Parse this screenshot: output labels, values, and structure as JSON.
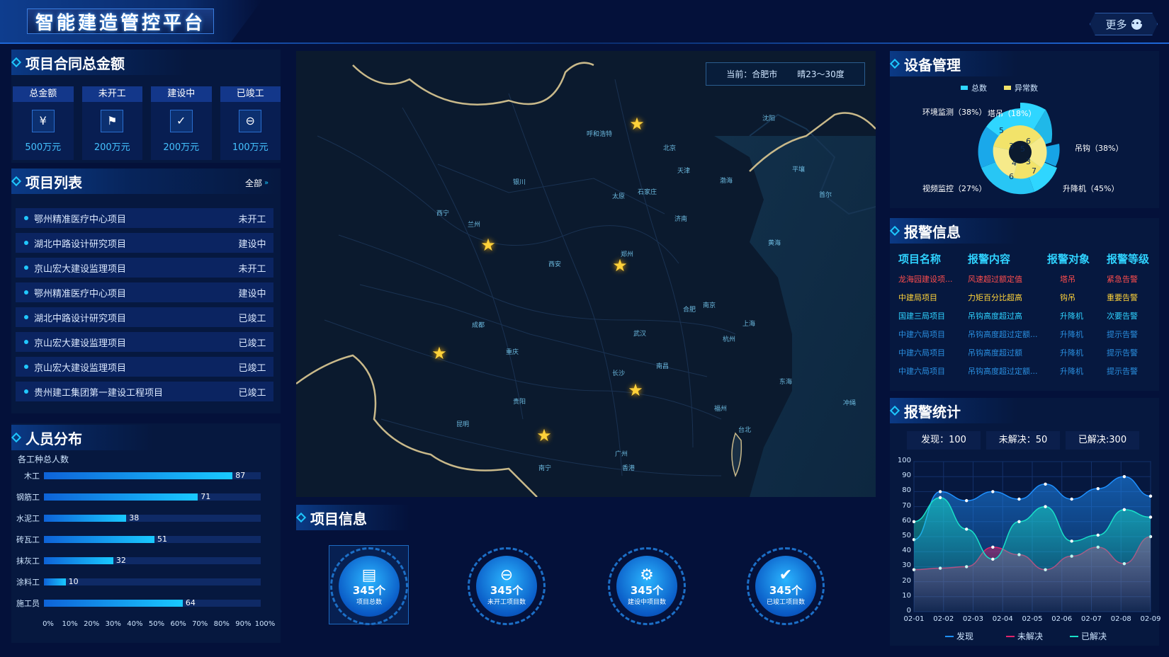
{
  "app": {
    "title": "智能建造管控平台",
    "more_label": "更多"
  },
  "contract": {
    "title": "项目合同总金额",
    "items": [
      {
        "head": "总金额",
        "icon": "money-bag-icon",
        "glyph": "💰",
        "value": "500万元"
      },
      {
        "head": "未开工",
        "icon": "flag-icon",
        "glyph": "⚑",
        "value": "200万元"
      },
      {
        "head": "建设中",
        "icon": "clipboard-check-icon",
        "glyph": "✓",
        "value": "200万元"
      },
      {
        "head": "已竣工",
        "icon": "minus-circle-icon",
        "glyph": "⊖",
        "value": "100万元"
      }
    ]
  },
  "project_list": {
    "title": "项目列表",
    "all_label": "全部",
    "rows": [
      {
        "name": "鄂州精准医疗中心项目",
        "status": "未开工"
      },
      {
        "name": "湖北中路设计研究项目",
        "status": "建设中"
      },
      {
        "name": "京山宏大建设监理项目",
        "status": "未开工"
      },
      {
        "name": "鄂州精准医疗中心项目",
        "status": "建设中"
      },
      {
        "name": "湖北中路设计研究项目",
        "status": "已竣工"
      },
      {
        "name": "京山宏大建设监理项目",
        "status": "已竣工"
      },
      {
        "name": "京山宏大建设监理项目",
        "status": "已竣工"
      },
      {
        "name": "贵州建工集团第一建设工程项目",
        "status": "已竣工"
      }
    ]
  },
  "people": {
    "title": "人员分布",
    "subtitle": "各工种总人数",
    "chart_data": {
      "type": "bar",
      "categories": [
        "木工",
        "钢筋工",
        "水泥工",
        "砖瓦工",
        "抹灰工",
        "涂料工",
        "施工员"
      ],
      "values": [
        87,
        71,
        38,
        51,
        32,
        10,
        64
      ],
      "xlim": [
        0,
        100
      ],
      "ticks": [
        "0%",
        "10%",
        "20%",
        "30%",
        "40%",
        "50%",
        "60%",
        "70%",
        "80%",
        "90%",
        "100%"
      ]
    }
  },
  "map": {
    "weather_city": "当前：合肥市",
    "weather": "晴23～30度",
    "cities": [
      "呼和浩特",
      "北京",
      "天津",
      "沈阳",
      "渤海",
      "石家庄",
      "太原",
      "银川",
      "兰州",
      "西宁",
      "济南",
      "郑州",
      "西安",
      "黄海",
      "南京",
      "合肥",
      "上海",
      "成都",
      "武汉",
      "重庆",
      "杭州",
      "长沙",
      "南昌",
      "东海",
      "贵阳",
      "福州",
      "昆明",
      "台北",
      "南宁",
      "广州",
      "香港",
      "首尔",
      "平壤",
      "冲绳"
    ]
  },
  "project_info": {
    "title": "项目信息",
    "items": [
      {
        "value": "345个",
        "label": "项目总数",
        "icon": "inbox-icon",
        "glyph": "▤"
      },
      {
        "value": "345个",
        "label": "未开工项目数",
        "icon": "minus-circle-icon",
        "glyph": "⊖"
      },
      {
        "value": "345个",
        "label": "建设中项目数",
        "icon": "building-gear-icon",
        "glyph": "⚙"
      },
      {
        "value": "345个",
        "label": "已竣工项目数",
        "icon": "document-check-icon",
        "glyph": "✔"
      }
    ]
  },
  "device": {
    "title": "设备管理",
    "legend": [
      {
        "label": "总数",
        "color": "#2fd6ff"
      },
      {
        "label": "异常数",
        "color": "#f2e36a"
      }
    ],
    "labels": [
      "塔吊（18%）",
      "吊钩（38%）",
      "升降机（45%）",
      "视频监控（27%）",
      "环境监测（38%）"
    ],
    "inner_values": [
      "5",
      "3",
      "6",
      "7",
      "6",
      "4",
      "3",
      "5"
    ]
  },
  "alarm": {
    "title": "报警信息",
    "headers": [
      "项目名称",
      "报警内容",
      "报警对象",
      "报警等级"
    ],
    "rows": [
      {
        "name": "龙海园建设项...",
        "content": "风速超过额定值",
        "target": "塔吊",
        "level": "紧急告警",
        "color": "#ff4d4d"
      },
      {
        "name": "中建局项目",
        "content": "力矩百分比超高",
        "target": "钩吊",
        "level": "重要告警",
        "color": "#ffd33a"
      },
      {
        "name": "国建三局项目",
        "content": "吊钩高度超过高",
        "target": "升降机",
        "level": "次要告警",
        "color": "#2fd2ff"
      },
      {
        "name": "中建六局项目",
        "content": "吊钩高度超过定额...",
        "target": "升降机",
        "level": "提示告警",
        "color": "#2a8fe0"
      },
      {
        "name": "中建六局项目",
        "content": "吊钩高度超过额",
        "target": "升降机",
        "level": "提示告警",
        "color": "#2a8fe0"
      },
      {
        "name": "中建六局项目",
        "content": "吊钩高度超过定额...",
        "target": "升降机",
        "level": "提示告警",
        "color": "#2a8fe0"
      }
    ]
  },
  "alarm_stats": {
    "title": "报警统计",
    "boxes": [
      "发现：100",
      "未解决：50",
      "已解决:300"
    ],
    "chart_data": {
      "type": "area",
      "x": [
        "02-01",
        "02-02",
        "02-03",
        "02-04",
        "02-05",
        "02-06",
        "02-07",
        "02-08",
        "02-09"
      ],
      "ylim": [
        0,
        100
      ],
      "yticks": [
        "0",
        "10",
        "20",
        "30",
        "40",
        "50",
        "60",
        "70",
        "80",
        "90",
        "100"
      ],
      "series": [
        {
          "name": "发现",
          "color": "#1e90ff",
          "values": [
            48,
            80,
            74,
            80,
            75,
            85,
            75,
            82,
            90,
            77
          ]
        },
        {
          "name": "未解决",
          "color": "#e0246b",
          "values": [
            28,
            29,
            30,
            43,
            38,
            28,
            37,
            43,
            32,
            50
          ]
        },
        {
          "name": "已解决",
          "color": "#19e0c8",
          "values": [
            60,
            76,
            55,
            35,
            60,
            70,
            47,
            51,
            68,
            63
          ]
        }
      ]
    }
  }
}
